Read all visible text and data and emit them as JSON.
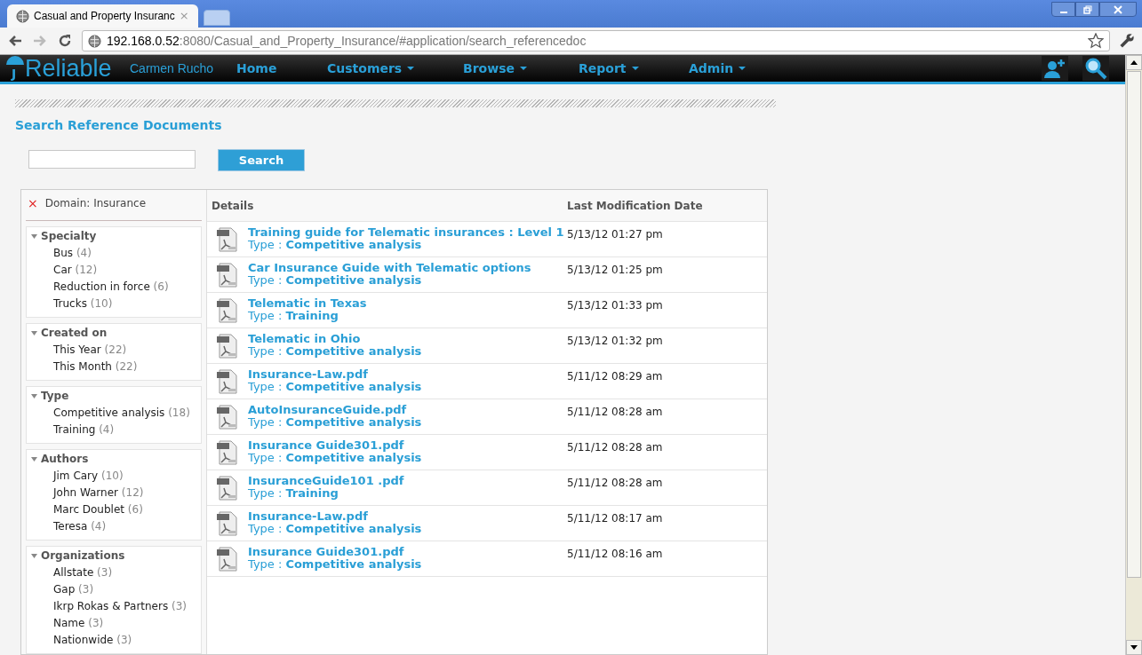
{
  "browser": {
    "tab_title": "Casual and Property Insuranc",
    "tab_close": "×",
    "url_host": "192.168.0.52",
    "url_rest": ":8080/Casual_and_Property_Insurance/#application/search_referencedoc"
  },
  "navbar": {
    "brand": "Reliable",
    "brand_mark": "J",
    "user": "Carmen Rucho",
    "menu": [
      {
        "label": "Home",
        "dropdown": false
      },
      {
        "label": "Customers",
        "dropdown": true
      },
      {
        "label": "Browse",
        "dropdown": true
      },
      {
        "label": "Report",
        "dropdown": true
      },
      {
        "label": "Admin",
        "dropdown": true
      }
    ]
  },
  "page_title": "Search Reference Documents",
  "search": {
    "button": "Search"
  },
  "filter": {
    "remove": "×",
    "label": "Domain: Insurance"
  },
  "facets": [
    {
      "title": "Specialty",
      "expanded": true,
      "items": [
        {
          "label": "Bus",
          "count": "(4)"
        },
        {
          "label": "Car",
          "count": "(12)"
        },
        {
          "label": "Reduction in force",
          "count": "(6)"
        },
        {
          "label": "Trucks",
          "count": "(10)"
        }
      ]
    },
    {
      "title": "Created on",
      "expanded": true,
      "items": [
        {
          "label": "This Year",
          "count": "(22)"
        },
        {
          "label": "This Month",
          "count": "(22)"
        }
      ]
    },
    {
      "title": "Type",
      "expanded": true,
      "items": [
        {
          "label": "Competitive analysis",
          "count": "(18)"
        },
        {
          "label": "Training",
          "count": "(4)"
        }
      ]
    },
    {
      "title": "Authors",
      "expanded": true,
      "items": [
        {
          "label": "Jim Cary",
          "count": "(10)"
        },
        {
          "label": "John Warner",
          "count": "(12)"
        },
        {
          "label": "Marc Doublet",
          "count": "(6)"
        },
        {
          "label": "Teresa",
          "count": "(4)"
        }
      ]
    },
    {
      "title": "Organizations",
      "expanded": true,
      "items": [
        {
          "label": "Allstate",
          "count": "(3)"
        },
        {
          "label": "Gap",
          "count": "(3)"
        },
        {
          "label": "Ikrp Rokas & Partners",
          "count": "(3)"
        },
        {
          "label": "Name",
          "count": "(3)"
        },
        {
          "label": "Nationwide",
          "count": "(3)"
        }
      ]
    }
  ],
  "table": {
    "columns": [
      "Details",
      "Last Modification Date"
    ],
    "rows": [
      {
        "title": "Training guide for Telematic insurances : Level 1",
        "type_label": "Type :",
        "type": "Competitive analysis",
        "date": "5/13/12 01:27 pm"
      },
      {
        "title": "Car Insurance Guide with Telematic options",
        "type_label": "Type :",
        "type": "Competitive analysis",
        "date": "5/13/12 01:25 pm"
      },
      {
        "title": "Telematic in Texas",
        "type_label": "Type :",
        "type": "Training",
        "date": "5/13/12 01:33 pm"
      },
      {
        "title": "Telematic in Ohio",
        "type_label": "Type :",
        "type": "Competitive analysis",
        "date": "5/13/12 01:32 pm"
      },
      {
        "title": "Insurance-Law.pdf",
        "type_label": "Type :",
        "type": "Competitive analysis",
        "date": "5/11/12 08:29 am"
      },
      {
        "title": "AutoInsuranceGuide.pdf",
        "type_label": "Type :",
        "type": "Competitive analysis",
        "date": "5/11/12 08:28 am"
      },
      {
        "title": "Insurance Guide301.pdf",
        "type_label": "Type :",
        "type": "Competitive analysis",
        "date": "5/11/12 08:28 am"
      },
      {
        "title": "InsuranceGuide101 .pdf",
        "type_label": "Type :",
        "type": "Training",
        "date": "5/11/12 08:28 am"
      },
      {
        "title": "Insurance-Law.pdf",
        "type_label": "Type :",
        "type": "Competitive analysis",
        "date": "5/11/12 08:17 am"
      },
      {
        "title": "Insurance Guide301.pdf",
        "type_label": "Type :",
        "type": "Competitive analysis",
        "date": "5/11/12 08:16 am"
      }
    ]
  }
}
